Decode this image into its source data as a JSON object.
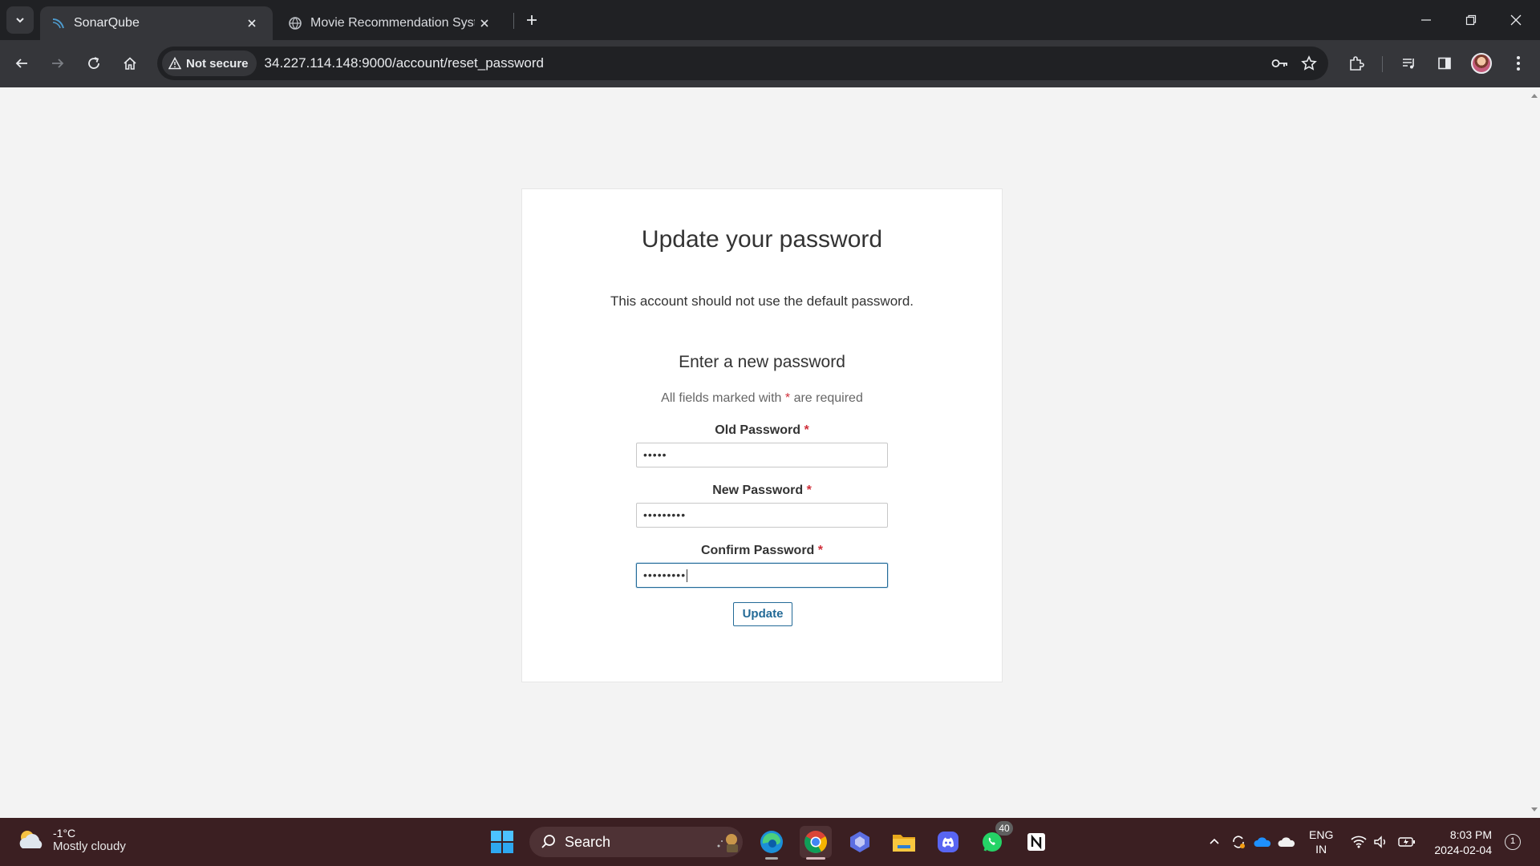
{
  "browser": {
    "tabs": [
      {
        "title": "SonarQube",
        "active": true
      },
      {
        "title": "Movie Recommendation System",
        "active": false
      }
    ],
    "security_label": "Not secure",
    "url": "34.227.114.148:9000/account/reset_password"
  },
  "page": {
    "title": "Update your password",
    "warning": "This account should not use the default password.",
    "subtitle": "Enter a new password",
    "required_note_before": "All fields marked with",
    "required_star": "*",
    "required_note_after": "are required",
    "fields": [
      {
        "label": "Old Password",
        "value": "•••••",
        "focused": false
      },
      {
        "label": "New Password",
        "value": "•••••••••",
        "focused": false
      },
      {
        "label": "Confirm Password",
        "value": "•••••••••",
        "focused": true
      }
    ],
    "submit_label": "Update"
  },
  "taskbar": {
    "weather_temp": "-1°C",
    "weather_desc": "Mostly cloudy",
    "search_label": "Search",
    "whatsapp_badge": "40",
    "lang_line1": "ENG",
    "lang_line2": "IN",
    "time": "8:03 PM",
    "date": "2024-02-04",
    "notification_count": "1"
  },
  "colors": {
    "accent": "#236a97",
    "required": "#d02f3a",
    "taskbar": "#3b1f22"
  }
}
